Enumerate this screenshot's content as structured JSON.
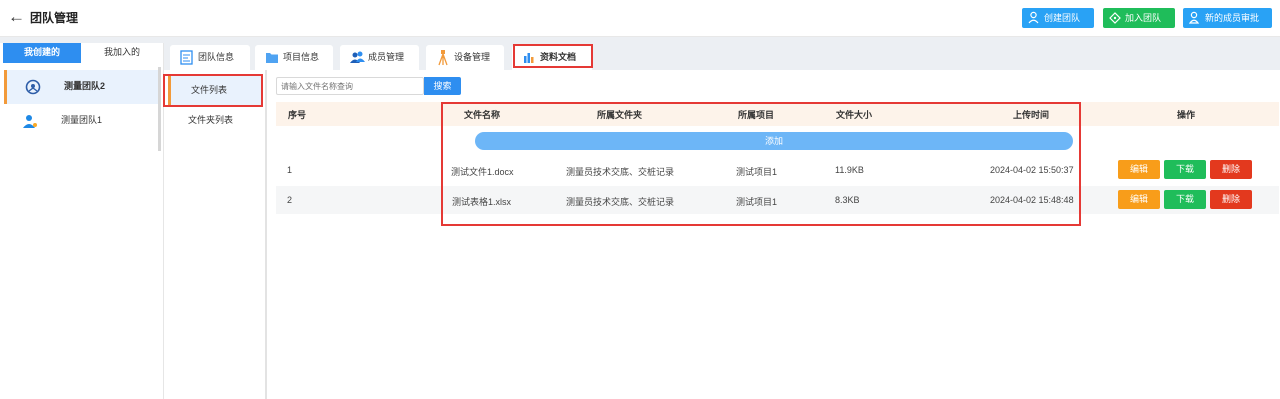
{
  "header": {
    "back_glyph": "←",
    "title": "团队管理",
    "buttons": {
      "create": {
        "label": "创建团队",
        "icon": "user-icon"
      },
      "join": {
        "label": "加入团队",
        "icon": "tag-icon"
      },
      "approve": {
        "label": "新的成员审批",
        "icon": "user-check-icon"
      }
    }
  },
  "left_tabs": {
    "created": "我创建的",
    "joined": "我加入的"
  },
  "teams": [
    {
      "name": "测量团队2",
      "selected": true
    },
    {
      "name": "测量团队1",
      "selected": false
    }
  ],
  "content_tabs": [
    {
      "label": "团队信息",
      "icon": "team-info-icon"
    },
    {
      "label": "项目信息",
      "icon": "folder-icon"
    },
    {
      "label": "成员管理",
      "icon": "members-icon"
    },
    {
      "label": "设备管理",
      "icon": "tripod-icon"
    },
    {
      "label": "资料文档",
      "icon": "docs-icon",
      "active": true
    }
  ],
  "sub_nav": {
    "file_list": "文件列表",
    "folder_list": "文件夹列表"
  },
  "search": {
    "placeholder": "请输入文件名称查询",
    "button": "搜索"
  },
  "table": {
    "columns": {
      "index": "序号",
      "name": "文件名称",
      "folder": "所属文件夹",
      "project": "所属项目",
      "size": "文件大小",
      "time": "上传时间",
      "actions": "操作"
    },
    "add_label": "添加",
    "rows": [
      {
        "index": "1",
        "name": "测试文件1.docx",
        "folder": "测量员技术交底、交桩记录",
        "project": "测试项目1",
        "size": "11.9KB",
        "time": "2024-04-02 15:50:37"
      },
      {
        "index": "2",
        "name": "测试表格1.xlsx",
        "folder": "测量员技术交底、交桩记录",
        "project": "测试项目1",
        "size": "8.3KB",
        "time": "2024-04-02 15:48:48"
      }
    ],
    "actions": {
      "edit": "编辑",
      "download": "下载",
      "delete": "删除"
    }
  },
  "colors": {
    "primary": "#2e8ef0",
    "success": "#1fbd5a",
    "warning": "#f89d1a",
    "danger": "#e3391e",
    "highlight_border": "#e53935",
    "selected_accent": "#f29a3a"
  }
}
